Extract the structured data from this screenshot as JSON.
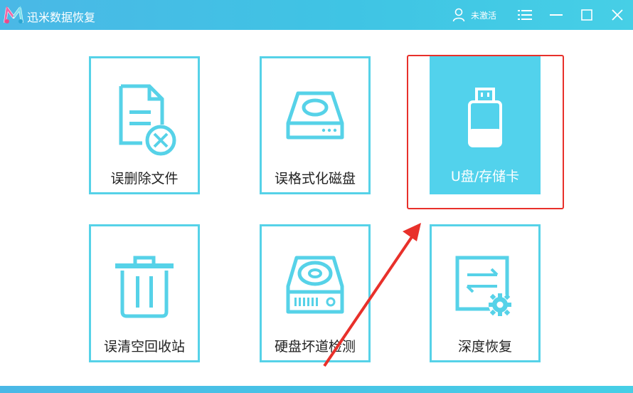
{
  "app": {
    "title": "迅米数据恢复"
  },
  "header": {
    "user_status": "未激活",
    "icons": {
      "menu": "menu-icon",
      "minimize": "minimize-icon",
      "maximize": "maximize-icon",
      "close": "close-icon"
    }
  },
  "tiles": [
    {
      "label": "误删除文件",
      "icon": "deleted-file-icon",
      "selected": false
    },
    {
      "label": "误格式化磁盘",
      "icon": "disk-icon",
      "selected": false
    },
    {
      "label": "U盘/存储卡",
      "icon": "usb-drive-icon",
      "selected": true
    },
    {
      "label": "误清空回收站",
      "icon": "trash-icon",
      "selected": false
    },
    {
      "label": "硬盘坏道检测",
      "icon": "hard-disk-check-icon",
      "selected": false
    },
    {
      "label": "深度恢复",
      "icon": "deep-recovery-icon",
      "selected": false
    }
  ],
  "colors": {
    "accent": "#56d2e8",
    "selected_bg": "#52d2ec",
    "annotation": "#e8302a",
    "titlebar": "#46c4e6"
  }
}
